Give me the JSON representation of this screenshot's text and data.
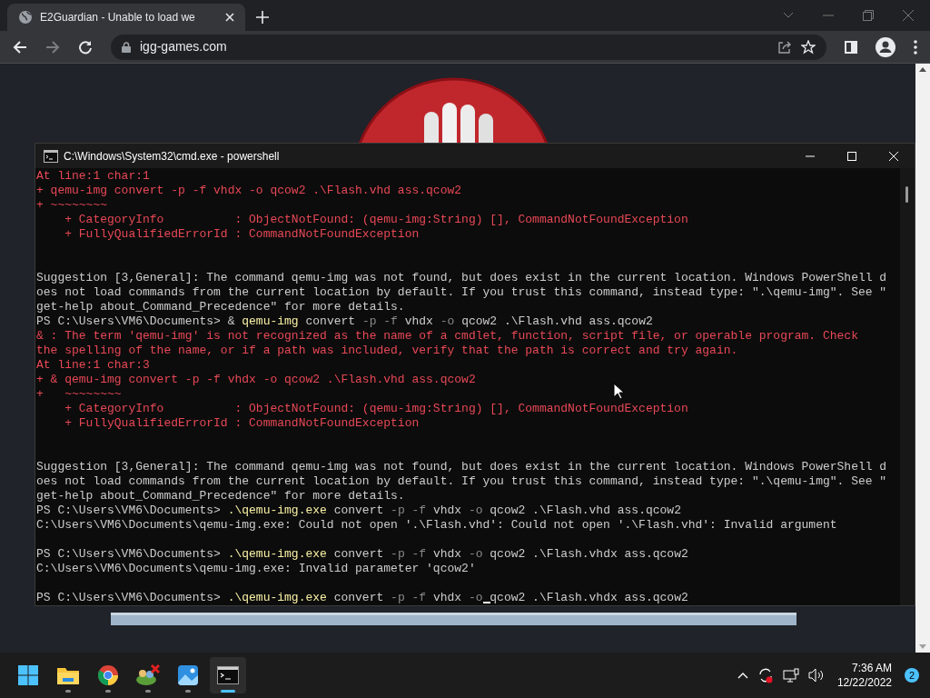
{
  "browser": {
    "tab": {
      "title": "E2Guardian - Unable to load we",
      "selected": true
    },
    "address": "igg-games.com"
  },
  "console": {
    "title": "C:\\Windows\\System32\\cmd.exe - powershell",
    "lines": [
      {
        "kind": "text",
        "segments": [
          {
            "kind": "error",
            "text": "At line:1 char:1"
          }
        ]
      },
      {
        "kind": "text",
        "segments": [
          {
            "kind": "error",
            "text": "+ qemu-img convert -p -f vhdx -o qcow2 .\\Flash.vhd ass.qcow2"
          }
        ]
      },
      {
        "kind": "text",
        "segments": [
          {
            "kind": "error",
            "text": "+ ~~~~~~~~"
          }
        ]
      },
      {
        "kind": "text",
        "segments": [
          {
            "kind": "error",
            "text": "    + CategoryInfo          : ObjectNotFound: (qemu-img:String) [], CommandNotFoundException"
          }
        ]
      },
      {
        "kind": "text",
        "segments": [
          {
            "kind": "error",
            "text": "    + FullyQualifiedErrorId : CommandNotFoundException"
          }
        ]
      },
      {
        "kind": "blank"
      },
      {
        "kind": "blank"
      },
      {
        "kind": "text",
        "segments": [
          {
            "kind": "plain",
            "text": "Suggestion [3,General]: The command qemu-img was not found, but does exist in the current location. Windows PowerShell d"
          }
        ]
      },
      {
        "kind": "text",
        "segments": [
          {
            "kind": "plain",
            "text": "oes not load commands from the current location by default. If you trust this command, instead type: \".\\qemu-img\". See \""
          }
        ]
      },
      {
        "kind": "text",
        "segments": [
          {
            "kind": "plain",
            "text": "get-help about_Command_Precedence\" for more details."
          }
        ]
      },
      {
        "kind": "text",
        "segments": [
          {
            "kind": "plain",
            "text": "PS C:\\Users\\VM6\\Documents> & "
          },
          {
            "kind": "command",
            "text": "qemu-img"
          },
          {
            "kind": "plain",
            "text": " convert "
          },
          {
            "kind": "param",
            "text": "-p -f"
          },
          {
            "kind": "plain",
            "text": " vhdx "
          },
          {
            "kind": "param",
            "text": "-o"
          },
          {
            "kind": "plain",
            "text": " qcow2 .\\Flash.vhd ass.qcow2"
          }
        ]
      },
      {
        "kind": "text",
        "segments": [
          {
            "kind": "error",
            "text": "& : The term 'qemu-img' is not recognized as the name of a cmdlet, function, script file, or operable program. Check"
          }
        ]
      },
      {
        "kind": "text",
        "segments": [
          {
            "kind": "error",
            "text": "the spelling of the name, or if a path was included, verify that the path is correct and try again."
          }
        ]
      },
      {
        "kind": "text",
        "segments": [
          {
            "kind": "error",
            "text": "At line:1 char:3"
          }
        ]
      },
      {
        "kind": "text",
        "segments": [
          {
            "kind": "error",
            "text": "+ & qemu-img convert -p -f vhdx -o qcow2 .\\Flash.vhd ass.qcow2"
          }
        ]
      },
      {
        "kind": "text",
        "segments": [
          {
            "kind": "error",
            "text": "+   ~~~~~~~~"
          }
        ]
      },
      {
        "kind": "text",
        "segments": [
          {
            "kind": "error",
            "text": "    + CategoryInfo          : ObjectNotFound: (qemu-img:String) [], CommandNotFoundException"
          }
        ]
      },
      {
        "kind": "text",
        "segments": [
          {
            "kind": "error",
            "text": "    + FullyQualifiedErrorId : CommandNotFoundException"
          }
        ]
      },
      {
        "kind": "blank"
      },
      {
        "kind": "blank"
      },
      {
        "kind": "text",
        "segments": [
          {
            "kind": "plain",
            "text": "Suggestion [3,General]: The command qemu-img was not found, but does exist in the current location. Windows PowerShell d"
          }
        ]
      },
      {
        "kind": "text",
        "segments": [
          {
            "kind": "plain",
            "text": "oes not load commands from the current location by default. If you trust this command, instead type: \".\\qemu-img\". See \""
          }
        ]
      },
      {
        "kind": "text",
        "segments": [
          {
            "kind": "plain",
            "text": "get-help about_Command_Precedence\" for more details."
          }
        ]
      },
      {
        "kind": "text",
        "segments": [
          {
            "kind": "plain",
            "text": "PS C:\\Users\\VM6\\Documents> "
          },
          {
            "kind": "command",
            "text": ".\\qemu-img.exe"
          },
          {
            "kind": "plain",
            "text": " convert "
          },
          {
            "kind": "param",
            "text": "-p -f"
          },
          {
            "kind": "plain",
            "text": " vhdx "
          },
          {
            "kind": "param",
            "text": "-o"
          },
          {
            "kind": "plain",
            "text": " qcow2 .\\Flash.vhd ass.qcow2"
          }
        ]
      },
      {
        "kind": "text",
        "segments": [
          {
            "kind": "plain",
            "text": "C:\\Users\\VM6\\Documents\\qemu-img.exe: Could not open '.\\Flash.vhd': Could not open '.\\Flash.vhd': Invalid argument"
          }
        ]
      },
      {
        "kind": "blank"
      },
      {
        "kind": "text",
        "segments": [
          {
            "kind": "plain",
            "text": "PS C:\\Users\\VM6\\Documents> "
          },
          {
            "kind": "command",
            "text": ".\\qemu-img.exe"
          },
          {
            "kind": "plain",
            "text": " convert "
          },
          {
            "kind": "param",
            "text": "-p -f"
          },
          {
            "kind": "plain",
            "text": " vhdx "
          },
          {
            "kind": "param",
            "text": "-o"
          },
          {
            "kind": "plain",
            "text": " qcow2 .\\Flash.vhdx ass.qcow2"
          }
        ]
      },
      {
        "kind": "text",
        "segments": [
          {
            "kind": "plain",
            "text": "C:\\Users\\VM6\\Documents\\qemu-img.exe: Invalid parameter 'qcow2'"
          }
        ]
      },
      {
        "kind": "blank"
      },
      {
        "kind": "text",
        "segments": [
          {
            "kind": "plain",
            "text": "PS C:\\Users\\VM6\\Documents> "
          },
          {
            "kind": "command",
            "text": ".\\qemu-img.exe"
          },
          {
            "kind": "plain",
            "text": " convert "
          },
          {
            "kind": "param",
            "text": "-p -f"
          },
          {
            "kind": "plain",
            "text": " vhdx "
          },
          {
            "kind": "param",
            "text": "-o"
          },
          {
            "kind": "plain",
            "text": " qcow2 .\\Flash.vhdx ass.qcow2",
            "cursor": true
          }
        ]
      }
    ]
  },
  "taskbar": {
    "apps": [
      {
        "kind": "start",
        "selected": false
      },
      {
        "kind": "folder",
        "selected": false
      },
      {
        "kind": "chrome",
        "selected": false
      },
      {
        "kind": "network",
        "selected": false
      },
      {
        "kind": "photos",
        "selected": false
      },
      {
        "kind": "terminal",
        "selected": true
      }
    ],
    "time": "7:36 AM",
    "date": "12/22/2022",
    "notifications": "2"
  }
}
